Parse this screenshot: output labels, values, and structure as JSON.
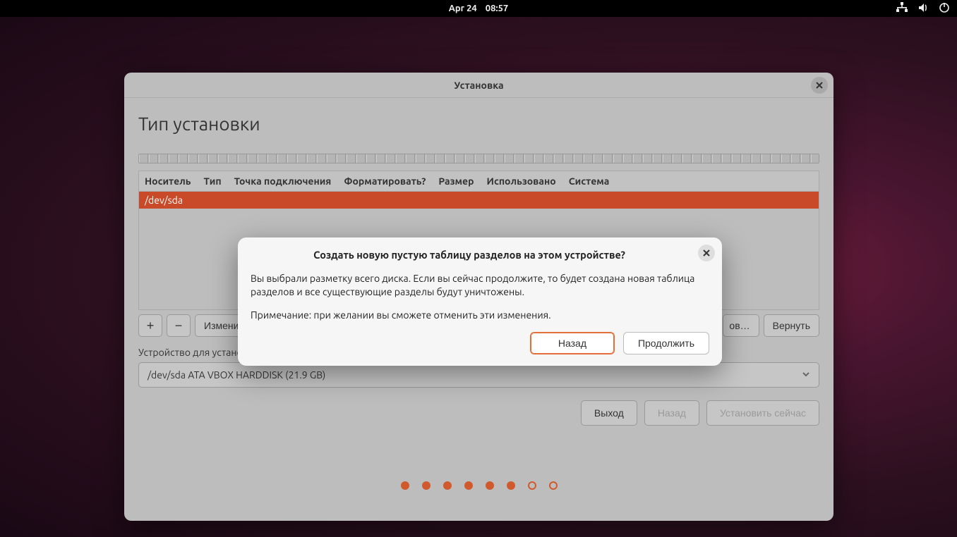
{
  "topbar": {
    "date": "Apr 24",
    "time": "08:57"
  },
  "window": {
    "title": "Установка",
    "heading": "Тип установки",
    "table": {
      "headers": [
        "Носитель",
        "Тип",
        "Точка подключения",
        "Форматировать?",
        "Размер",
        "Использовано",
        "Система"
      ],
      "rows": [
        {
          "device": "/dev/sda"
        }
      ]
    },
    "toolbar": {
      "add": "+",
      "remove": "−",
      "change": "Измени",
      "new_table": "ов…",
      "revert": "Вернуть"
    },
    "bootloader_label": "Устройство для установки системного загрузчика:",
    "bootloader_value": "/dev/sda ATA VBOX HARDDISK (21.9 GB)",
    "buttons": {
      "quit": "Выход",
      "back": "Назад",
      "install": "Установить сейчас"
    }
  },
  "modal": {
    "title": "Создать новую пустую таблицу разделов на этом устройстве?",
    "body1": "Вы выбрали разметку всего диска. Если вы сейчас продолжите, то будет создана новая таблица разделов и все существующие разделы будут уничтожены.",
    "body2": "Примечание: при желании вы сможете отменить эти изменения.",
    "back": "Назад",
    "continue": "Продолжить"
  },
  "pager": {
    "total": 8,
    "current": 6
  }
}
